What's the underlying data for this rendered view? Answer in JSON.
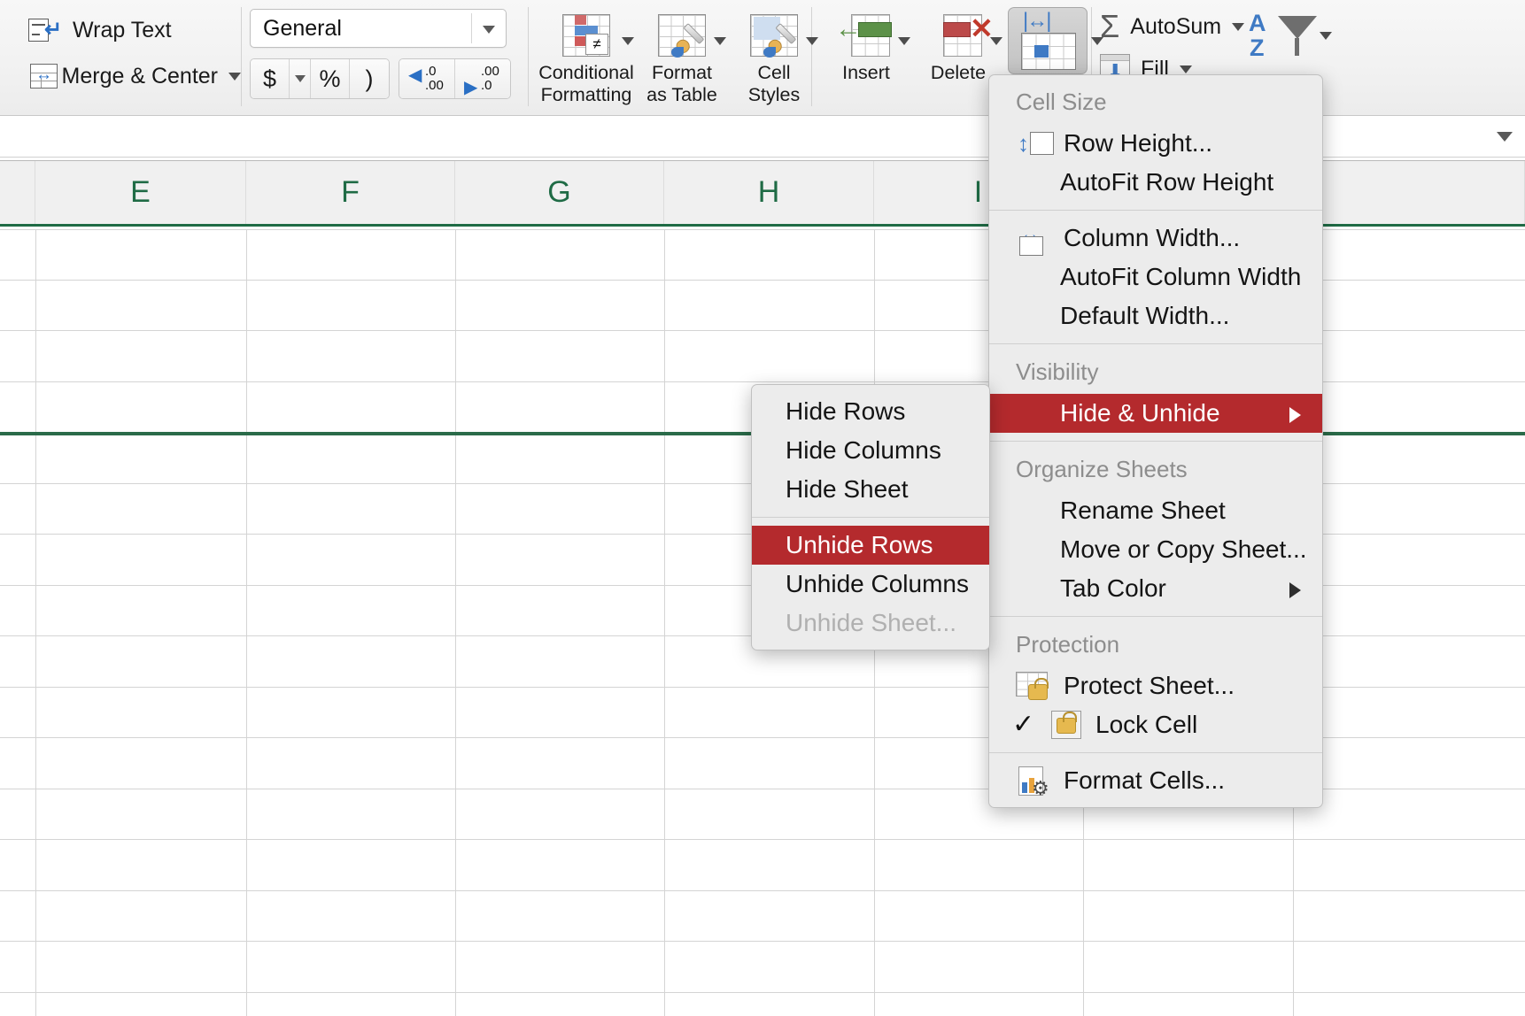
{
  "ribbon": {
    "alignment": {
      "wrap_text_label": "Wrap Text",
      "merge_center_label": "Merge & Center"
    },
    "number": {
      "format_value": "General",
      "currency_symbol": "$",
      "percent_symbol": "%",
      "comma_symbol": ")",
      "decrease_decimal": {
        "top": ".0",
        "bottom": ".00"
      },
      "increase_decimal": {
        "top": ".00",
        "bottom": ".0"
      }
    },
    "styles": {
      "conditional_formatting_line1": "Conditional",
      "conditional_formatting_line2": "Formatting",
      "conditional_badge": "≠",
      "format_as_table_line1": "Format",
      "format_as_table_line2": "as Table",
      "cell_styles_line1": "Cell",
      "cell_styles_line2": "Styles"
    },
    "cells": {
      "insert_label": "Insert",
      "delete_label": "Delete"
    },
    "editing": {
      "autosum_label": "AutoSum",
      "fill_label": "Fill",
      "sort_a": "A",
      "sort_z": "Z"
    }
  },
  "column_headers": [
    "E",
    "F",
    "G",
    "H",
    "I"
  ],
  "format_menu": {
    "sections": [
      {
        "header": "Cell Size",
        "items": [
          {
            "label": "Row Height...",
            "icon": "row-height-icon",
            "indent": false,
            "selected": false,
            "disabled": false,
            "submenu": false
          },
          {
            "label": "AutoFit Row Height",
            "icon": null,
            "indent": true,
            "selected": false,
            "disabled": false,
            "submenu": false
          }
        ]
      },
      {
        "header": null,
        "items": [
          {
            "label": "Column Width...",
            "icon": "column-width-icon",
            "indent": false,
            "selected": false,
            "disabled": false,
            "submenu": false
          },
          {
            "label": "AutoFit Column Width",
            "icon": null,
            "indent": true,
            "selected": false,
            "disabled": false,
            "submenu": false
          },
          {
            "label": "Default Width...",
            "icon": null,
            "indent": true,
            "selected": false,
            "disabled": false,
            "submenu": false
          }
        ]
      },
      {
        "header": "Visibility",
        "items": [
          {
            "label": "Hide & Unhide",
            "icon": null,
            "indent": true,
            "selected": true,
            "disabled": false,
            "submenu": true
          }
        ]
      },
      {
        "header": "Organize Sheets",
        "items": [
          {
            "label": "Rename Sheet",
            "icon": null,
            "indent": true,
            "selected": false,
            "disabled": false,
            "submenu": false
          },
          {
            "label": "Move or Copy Sheet...",
            "icon": null,
            "indent": true,
            "selected": false,
            "disabled": false,
            "submenu": false
          },
          {
            "label": "Tab Color",
            "icon": null,
            "indent": true,
            "selected": false,
            "disabled": false,
            "submenu": true
          }
        ]
      },
      {
        "header": "Protection",
        "items": [
          {
            "label": "Protect Sheet...",
            "icon": "protect-sheet-icon",
            "indent": false,
            "selected": false,
            "disabled": false,
            "submenu": false
          },
          {
            "label": "Lock Cell",
            "icon": "lock-cell-icon",
            "indent": false,
            "selected": false,
            "disabled": false,
            "submenu": false,
            "checked": true
          }
        ]
      },
      {
        "header": null,
        "items": [
          {
            "label": "Format Cells...",
            "icon": "format-cells-icon",
            "indent": false,
            "selected": false,
            "disabled": false,
            "submenu": false
          }
        ]
      }
    ]
  },
  "hide_unhide_submenu": {
    "groups": [
      [
        {
          "label": "Hide Rows",
          "selected": false,
          "disabled": false
        },
        {
          "label": "Hide Columns",
          "selected": false,
          "disabled": false
        },
        {
          "label": "Hide Sheet",
          "selected": false,
          "disabled": false
        }
      ],
      [
        {
          "label": "Unhide Rows",
          "selected": true,
          "disabled": false
        },
        {
          "label": "Unhide Columns",
          "selected": false,
          "disabled": false
        },
        {
          "label": "Unhide Sheet...",
          "selected": false,
          "disabled": true
        }
      ]
    ]
  },
  "colors": {
    "menu_highlight": "#b42a2d",
    "header_text": "#1f6b45",
    "grid_line": "#d4d4d4",
    "selection_line": "#2a6b49"
  }
}
